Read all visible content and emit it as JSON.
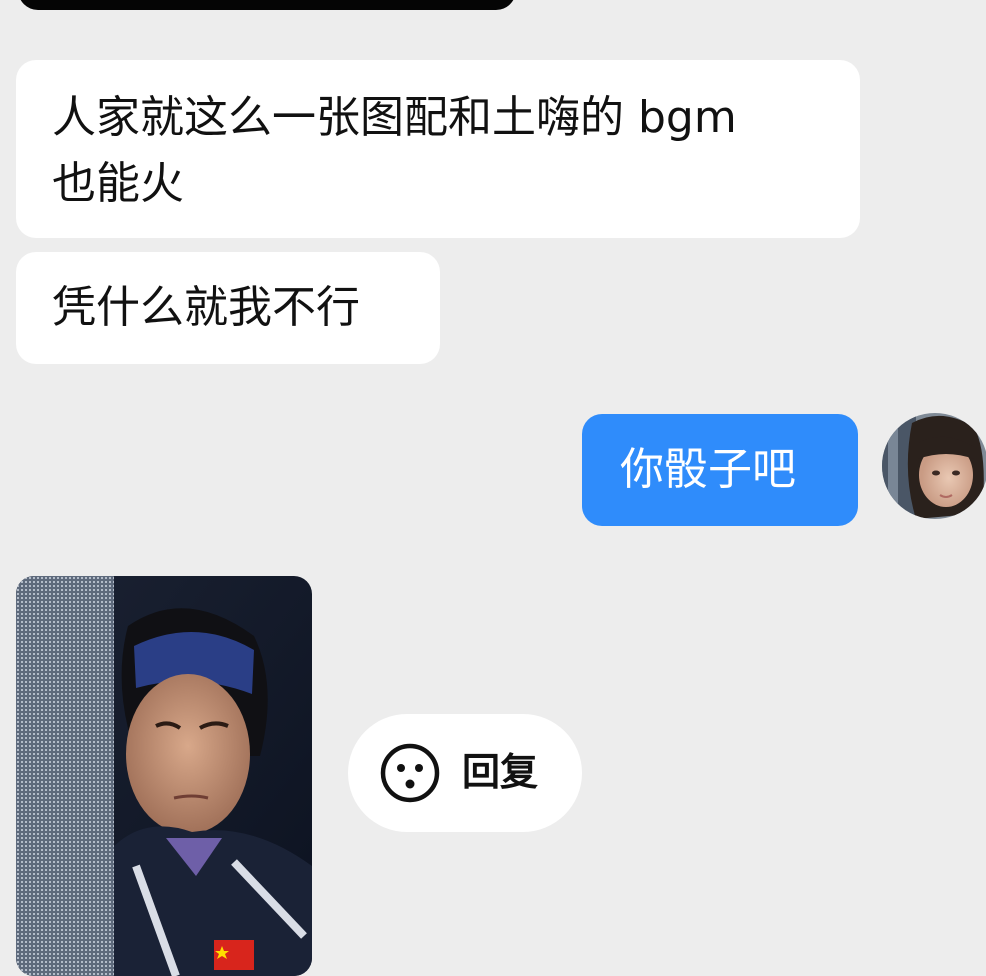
{
  "messages": [
    {
      "direction": "incoming",
      "lines": [
        "人家就这么一张图配和土嗨的 bgm",
        "也能火"
      ]
    },
    {
      "direction": "incoming",
      "text": "凭什么就我不行"
    },
    {
      "direction": "outgoing",
      "text": "你骰子吧"
    }
  ],
  "reply_action": {
    "label": "回复",
    "icon": "emoji-face-icon"
  },
  "colors": {
    "background": "#ededed",
    "incoming_bubble": "#ffffff",
    "outgoing_bubble": "#2f8cfb",
    "text": "#111111"
  }
}
